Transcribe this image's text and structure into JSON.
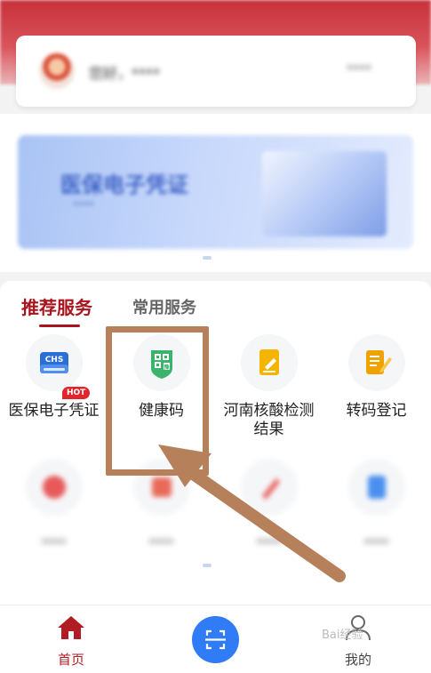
{
  "header": {
    "greeting": "您好，****",
    "name_link": "****"
  },
  "banner": {
    "title": "医保电子凭证",
    "subtitle": "****"
  },
  "tabs": [
    {
      "label": "推荐服务",
      "active": true
    },
    {
      "label": "常用服务",
      "active": false
    }
  ],
  "services_row1": [
    {
      "label": "医保电子凭证",
      "icon": "medical-insurance-card-icon",
      "badge": "HOT",
      "icon_text": "CHS"
    },
    {
      "label": "健康码",
      "icon": "health-code-icon"
    },
    {
      "label": "河南核酸检测结果",
      "icon": "nucleic-test-icon"
    },
    {
      "label": "转码登记",
      "icon": "transcode-register-icon"
    }
  ],
  "services_row2": [
    {
      "label": "****",
      "icon": "blurred-service-icon"
    },
    {
      "label": "****",
      "icon": "blurred-service-icon"
    },
    {
      "label": "****",
      "icon": "blurred-service-icon"
    },
    {
      "label": "****",
      "icon": "blurred-service-icon"
    }
  ],
  "bottom_nav": {
    "home_label": "首页",
    "mine_label": "我的",
    "watermark": "Bai经验"
  },
  "colors": {
    "brand_red": "#a8141d",
    "scan_blue": "#2f7cf6",
    "annotation": "#b5805a"
  }
}
